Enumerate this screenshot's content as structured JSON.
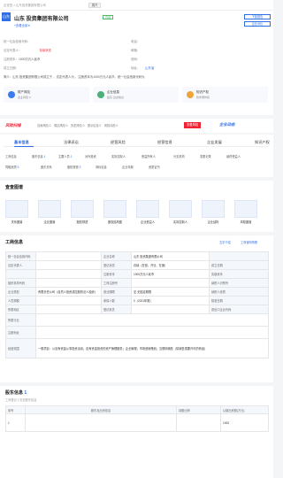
{
  "topbar": {
    "crumb": "企查查 > 山东投资集团有限公司",
    "btn": "展开"
  },
  "company": {
    "logo": "山东",
    "name": "山东  投资集团有限公司",
    "status": "存续",
    "tagline": "+查看全部 ▾",
    "follow": "关注",
    "download": "下载报告",
    "compare": "企业对比"
  },
  "info": {
    "r1a": "统一社会信用代码：",
    "r1b": "电话：",
    "r2a": "法定代表人：",
    "r2a_v": "存续状态",
    "r2b": "邮箱：",
    "r3a": "注册资本：",
    "r3a_v": "1000万元人民币",
    "r3b": "官网：",
    "r4a": "成立日期：",
    "r4b": "地址：",
    "r4b_v": "山东省",
    "r5": "简介：山东    投资集团有限公司成立于         ，法定代表人为          ，注册资本为1000万元人民币，统一社会信用代码为"
  },
  "stats": [
    {
      "title": "财产风险",
      "sub": "企业风险 0",
      "color": "#3b7bf0"
    },
    {
      "title": "企业信息",
      "sub": "股东·出资信息",
      "color": "#4bb07a"
    },
    {
      "title": "知识产权",
      "sub": "软件著作权",
      "color": "#f0a23b"
    }
  ],
  "riskbar": {
    "label": "风险扫描",
    "items": [
      "自身风险 0",
      "周边风险 0",
      "历史风险 0",
      "提示信息 0",
      "风险动态 0"
    ],
    "btn": "查看风险",
    "brand": "企业动态"
  },
  "tabs": [
    "基本信息",
    "法律诉讼",
    "经营风险",
    "经营信息",
    "企业发展",
    "知识产权"
  ],
  "tags1": [
    [
      "工商信息",
      ""
    ],
    [
      "股东信息",
      "1"
    ],
    [
      "主要人员",
      "1"
    ],
    [
      "对外投资",
      ""
    ],
    [
      "实际控制人",
      ""
    ],
    [
      "受益所有人",
      ""
    ],
    [
      "分支机构",
      ""
    ],
    [
      "变更记录",
      ""
    ],
    [
      "最终受益人",
      ""
    ]
  ],
  "tags2": [
    [
      "同融资质",
      "5"
    ],
    [
      "股东关系",
      ""
    ],
    [
      "股权穿透",
      "3"
    ],
    [
      "商标信息",
      ""
    ],
    [
      "企业年报",
      ""
    ],
    [
      "资质证书",
      ""
    ]
  ],
  "map": {
    "title": "查查图谱",
    "items": [
      "关系图谱",
      "企业图谱",
      "股权穿透",
      "股权结构图",
      "企业受益人",
      "实际控制人",
      "企业结构",
      "风险图谱"
    ]
  },
  "business": {
    "title": "工商信息",
    "action": "文字介绍",
    "export": "工商官网快照",
    "rows": [
      [
        "统一社会信用代码",
        "",
        "企业名称",
        "山东    投资集团有限公司",
        ""
      ],
      [
        "法定代表人",
        "",
        "登记状态",
        "存续（在营、开业、在册）",
        "成立日期"
      ],
      [
        "",
        "",
        "注册资本",
        "1000万元人民币",
        "实缴资本"
      ],
      [
        "组织机构代码",
        "",
        "工商注册号",
        "",
        "纳税人识别号"
      ],
      [
        "企业类型",
        "有限责任公司（自然人投资或控股的法人独资）",
        "营业期限",
        "至 无固定期限",
        "纳税人资质"
      ],
      [
        "人员规模",
        "",
        "参保人数",
        "0（2021年报）",
        "核准日期"
      ],
      [
        "所属地区",
        "",
        "登记机关",
        "",
        "进出口企业代码"
      ],
      [
        "所属行业",
        "",
        "",
        "",
        ""
      ],
      [
        "注册地址",
        "",
        "",
        "",
        ""
      ],
      [
        "经营范围",
        "一般项目：以自有资金从事投资活动；自有资金投资的资产管理服务；企业管理；市场营销策划；互联网销售（除销售需要许可的商品）",
        "",
        "",
        ""
      ]
    ]
  },
  "shareholders": {
    "title": "股东信息",
    "count": "1",
    "sub": "工商登记 1  历史股东信息",
    "cols": [
      "序号",
      "股东及出资信息",
      "持股比例",
      "认缴出资额(万元)"
    ],
    "row": [
      "1",
      "",
      "",
      "1000"
    ]
  }
}
